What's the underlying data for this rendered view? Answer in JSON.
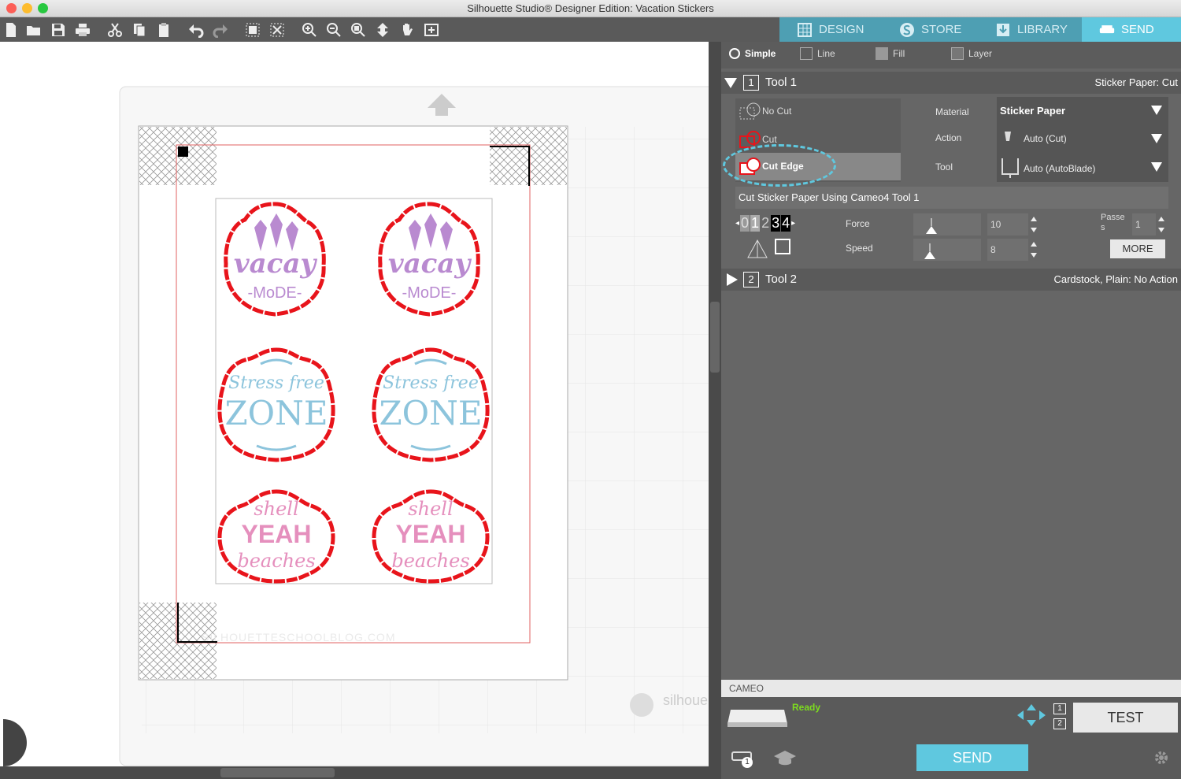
{
  "window": {
    "title": "Silhouette Studio® Designer Edition: Vacation Stickers"
  },
  "nav": {
    "design": "DESIGN",
    "store": "STORE",
    "library": "LIBRARY",
    "send": "SEND"
  },
  "mode_tabs": {
    "simple": "Simple",
    "line": "Line",
    "fill": "Fill",
    "layer": "Layer"
  },
  "tool1": {
    "number": "1",
    "label": "Tool 1",
    "summary": "Sticker Paper: Cut",
    "actions": [
      "No Cut",
      "Cut",
      "Cut Edge"
    ],
    "selected_action": "Cut Edge",
    "material_label": "Material",
    "material_value": "Sticker Paper",
    "action_label": "Action",
    "action_value": "Auto (Cut)",
    "tool_label": "Tool",
    "tool_value": "Auto (AutoBlade)",
    "heading": "Cut Sticker Paper Using Cameo4 Tool 1",
    "blade_digits": [
      "0",
      "1",
      "2",
      "3",
      "4"
    ],
    "force_label": "Force",
    "force_value": "10",
    "speed_label": "Speed",
    "speed_value": "8",
    "passes_label": "Passe s",
    "passes_value": "1",
    "more_label": "MORE"
  },
  "tool2": {
    "number": "2",
    "label": "Tool 2",
    "summary": "Cardstock, Plain: No Action"
  },
  "device": {
    "name": "CAMEO",
    "status": "Ready",
    "tool_numbers": [
      "1",
      "2"
    ],
    "test_label": "TEST",
    "send_label": "SEND",
    "badge": "1"
  },
  "canvas": {
    "watermark": "SILHOUETTESCHOOLBLOG.COM",
    "brand": "silhoue",
    "stickers": [
      {
        "line1": "vacay",
        "line2": "-MoDE-",
        "color": "#b98ad0"
      },
      {
        "line1": "vacay",
        "line2": "-MoDE-",
        "color": "#b98ad0"
      },
      {
        "line1": "Stress free",
        "line2": "ZONE",
        "color": "#8cc4dc"
      },
      {
        "line1": "Stress free",
        "line2": "ZONE",
        "color": "#8cc4dc"
      },
      {
        "line1": "shell",
        "line2": "YEAH",
        "line3": "beaches",
        "color": "#e58fbd"
      },
      {
        "line1": "shell",
        "line2": "YEAH",
        "line3": "beaches",
        "color": "#e58fbd"
      }
    ]
  },
  "colors": {
    "accent": "#5fc8df",
    "cut_line": "#e8141b",
    "panel": "#666666"
  }
}
